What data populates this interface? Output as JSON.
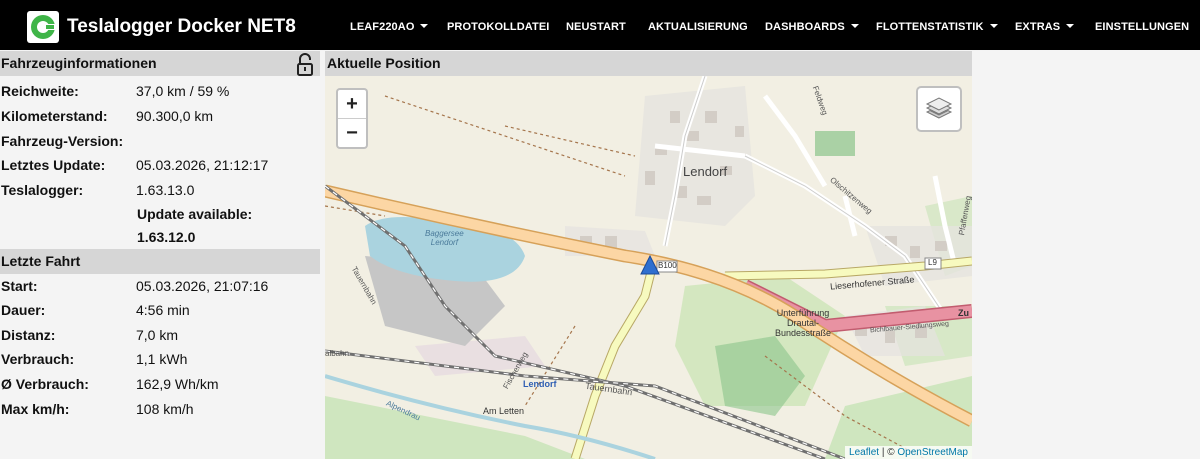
{
  "navbar": {
    "brand_title": "Teslalogger Docker NET8",
    "items": [
      {
        "label": "LEAF220AO",
        "dropdown": true
      },
      {
        "label": "PROTOKOLLDATEI",
        "dropdown": false
      },
      {
        "label": "NEUSTART",
        "dropdown": false
      },
      {
        "label": "AKTUALISIERUNG",
        "dropdown": false
      },
      {
        "label": "DASHBOARDS",
        "dropdown": true
      },
      {
        "label": "FLOTTENSTATISTIK",
        "dropdown": true
      },
      {
        "label": "EXTRAS",
        "dropdown": true
      },
      {
        "label": "EINSTELLUNGEN",
        "dropdown": false
      }
    ]
  },
  "vehicle_info": {
    "header": "Fahrzeuginformationen",
    "lock_icon": "unlocked-padlock-icon",
    "rows": [
      {
        "label": "Reichweite:",
        "value": "37,0 km / 59 %"
      },
      {
        "label": "Kilometerstand:",
        "value": "90.300,0 km"
      },
      {
        "label": "Fahrzeug-Version:",
        "value": ""
      },
      {
        "label": "Letztes Update:",
        "value": "05.03.2026, 21:12:17"
      },
      {
        "label": "Teslalogger:",
        "value": "1.63.13.0"
      }
    ],
    "update_available_label": "Update available:",
    "update_version": "1.63.12.0"
  },
  "last_trip": {
    "header": "Letzte Fahrt",
    "rows": [
      {
        "label": "Start:",
        "value": "05.03.2026, 21:07:16"
      },
      {
        "label": "Dauer:",
        "value": "4:56 min"
      },
      {
        "label": "Distanz:",
        "value": "7,0 km"
      },
      {
        "label": "Verbrauch:",
        "value": "1,1 kWh"
      },
      {
        "label": "Ø Verbrauch:",
        "value": "162,9 Wh/km"
      },
      {
        "label": "Max km/h:",
        "value": "108 km/h"
      }
    ]
  },
  "map": {
    "header": "Aktuelle Position",
    "zoom_in": "+",
    "zoom_out": "−",
    "layers_icon": "layers-icon",
    "labels": {
      "village": "Lendorf",
      "lake": "Baggersee\nLendorf",
      "b100": "B100",
      "l9": "L9",
      "lieserhofener": "Lieserhofener Straße",
      "unterfuehrung": "Unterführung\nDrautal-\nBundesstraße",
      "tauernbahn1": "Tauernbahn",
      "tauernbahn2": "Tauernbahn",
      "station": "Lendorf",
      "am_letten": "Am Letten",
      "fischerweg": "Fischerweg",
      "bichlbauer": "Bichlbauer-Siedlungsweg",
      "olschitzenweg": "Olschitzenweg",
      "pfaffenweg": "Pfaffenweg",
      "feldweg": "Feldweg",
      "zu": "Zu",
      "halbahn": "albahn",
      "alpendrau": "Alpendrau"
    },
    "attribution_leaflet": "Leaflet",
    "attribution_sep": " | © ",
    "attribution_osm": "OpenStreetMap",
    "colors": {
      "background": "#f2efe3",
      "lake": "#aad3df",
      "primary_road": "#fcd6a4",
      "motorway": "#e892a2",
      "secondary_road": "#f7fabf",
      "forest": "#add19e",
      "residential": "#e0dfdf",
      "marker": "#2f6fcf"
    }
  }
}
